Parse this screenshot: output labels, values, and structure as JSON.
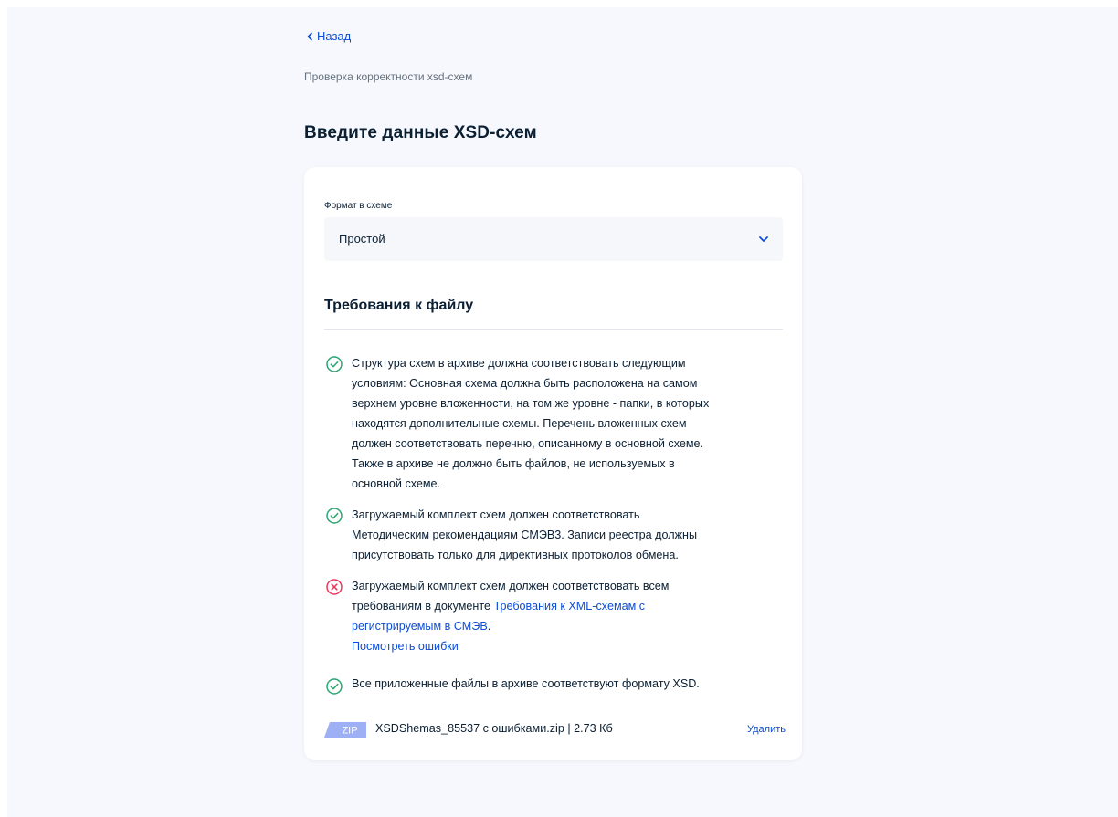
{
  "back": {
    "label": "Назад"
  },
  "breadcrumb": "Проверка корректности xsd-схем",
  "page_title": "Введите данные XSD-схем",
  "form": {
    "format_label": "Формат в схеме",
    "format_value": "Простой"
  },
  "requirements": {
    "title": "Требования к файлу",
    "items": [
      {
        "status": "ok",
        "lines": [
          "Структура схем в архиве должна соответствовать следующим",
          "условиям: Основная схема должна быть расположена на самом",
          "верхнем уровне вложенности, на том же уровне - папки, в которых",
          "находятся дополнительные схемы. Перечень вложенных схем",
          "должен соответствовать перечню, описанному в основной схеме.",
          "Также в архиве не должно быть файлов, не используемых в",
          "основной схеме."
        ]
      },
      {
        "status": "ok",
        "lines": [
          "Загружаемый комплект схем должен соответствовать",
          "Методическим рекомендациям СМЭВ3. Записи реестра должны",
          "присутствовать только для директивных протоколов обмена."
        ]
      },
      {
        "status": "error",
        "text_before_link": "Загружаемый комплект схем должен соответствовать всем",
        "text_line2_prefix": "требованиям в документе",
        "doc_link_part1": "Требования к XML-схемам с",
        "doc_link_part2": "регистрируемым в СМЭВ",
        "text_after_link": ".",
        "errors_link": "Посмотреть ошибки"
      },
      {
        "status": "ok",
        "lines": [
          "Все приложенные файлы в архиве соответствуют формату XSD."
        ]
      }
    ]
  },
  "file": {
    "badge": "ZIP",
    "name": "XSDShemas_85537 с ошибками.zip | 2.73 Кб",
    "delete_label": "Удалить"
  },
  "colors": {
    "accent": "#0d4cd3",
    "success": "#2aa672",
    "error": "#e9365b",
    "page_bg": "#f6f8fd",
    "card_bg": "#ffffff",
    "badge": "#9daff5"
  },
  "icons": {
    "back": "chevron-left-icon",
    "select": "chevron-down-icon",
    "ok": "check-circle-icon",
    "error": "cross-circle-icon",
    "file": "zip-file-icon"
  }
}
